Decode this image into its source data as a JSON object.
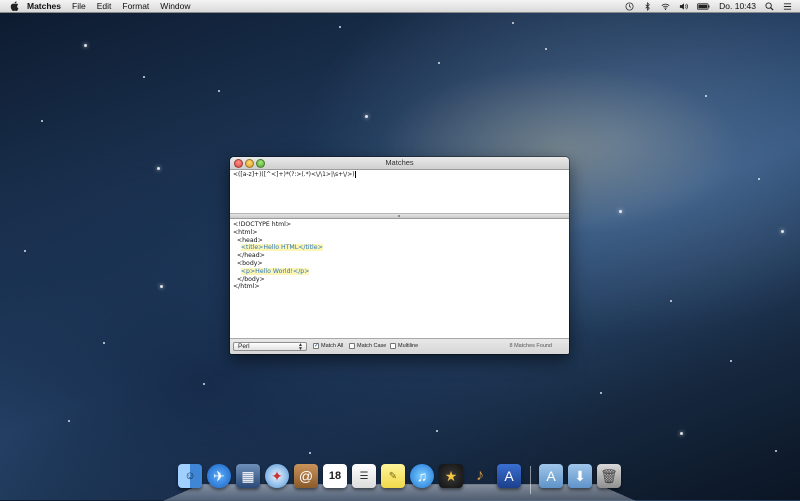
{
  "menubar": {
    "app_name": "Matches",
    "menus": [
      "File",
      "Edit",
      "Format",
      "Window"
    ],
    "clock": "Do. 10:43"
  },
  "window": {
    "title": "Matches",
    "regex": "<([a-z]+)([^<]+)*(?:>(.*)<\\/\\1>|\\s+\\/>)",
    "text_lines": [
      {
        "pre": "<!DOCTYPE html>",
        "match": "",
        "post": ""
      },
      {
        "pre": "<html>",
        "match": "",
        "post": ""
      },
      {
        "pre": "  <head>",
        "match": "",
        "post": ""
      },
      {
        "pre": "    ",
        "match": "<title>Hello HTML</title>",
        "post": ""
      },
      {
        "pre": "  </head>",
        "match": "",
        "post": ""
      },
      {
        "pre": "  <body>",
        "match": "",
        "post": ""
      },
      {
        "pre": "    ",
        "match": "<p>Hello World!</p>",
        "post": ""
      },
      {
        "pre": "  </body>",
        "match": "",
        "post": ""
      },
      {
        "pre": "</html>",
        "match": "",
        "post": ""
      }
    ],
    "syntax": "Perl",
    "options": {
      "match_all": "Match All",
      "match_case": "Match Case",
      "multiline": "Multiline"
    },
    "status": "8 Matches Found"
  },
  "colors": {
    "highlight_bg": "#fdf6b5",
    "highlight_text": "#2a77c6"
  }
}
